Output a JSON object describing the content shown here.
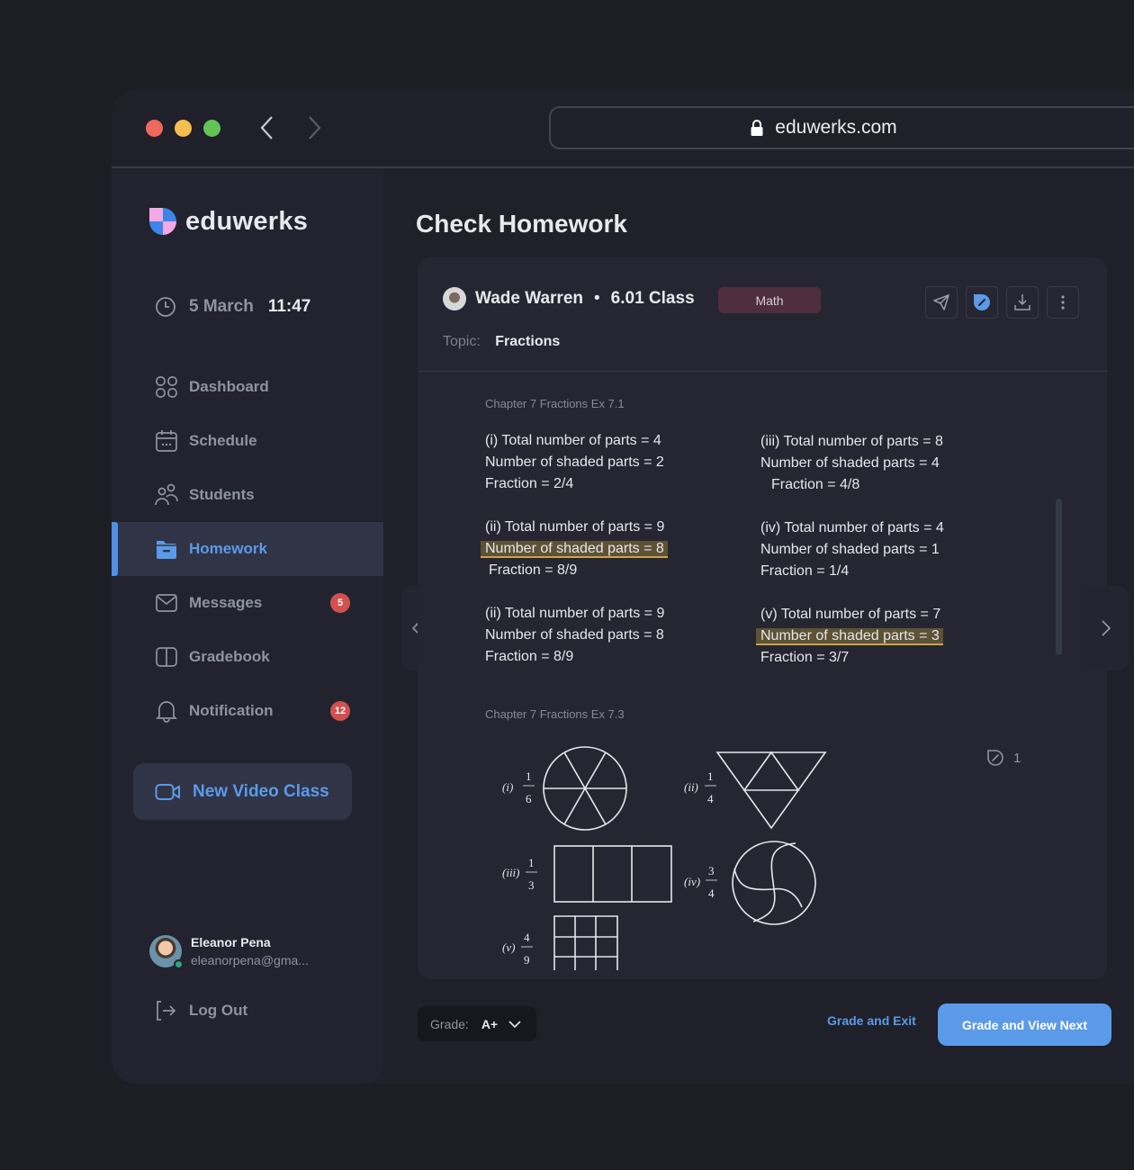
{
  "browser": {
    "url": "eduwerks.com",
    "icons": {
      "back": "chevron-left-icon",
      "forward": "chevron-right-icon",
      "lock": "lock-icon"
    }
  },
  "sidebar": {
    "brand": "eduwerks",
    "date": "5 March",
    "time": "11:47",
    "items": [
      {
        "label": "Dashboard",
        "icon": "grid-icon",
        "active": false
      },
      {
        "label": "Schedule",
        "icon": "calendar-icon",
        "active": false
      },
      {
        "label": "Students",
        "icon": "users-icon",
        "active": false
      },
      {
        "label": "Homework",
        "icon": "folder-icon",
        "active": true
      },
      {
        "label": "Messages",
        "icon": "mail-icon",
        "active": false,
        "badge": "5"
      },
      {
        "label": "Gradebook",
        "icon": "book-icon",
        "active": false
      },
      {
        "label": "Notification",
        "icon": "bell-icon",
        "active": false,
        "badge": "12"
      }
    ],
    "video_button": "New Video Class",
    "user": {
      "name": "Eleanor Pena",
      "email": "eleanorpena@gma..."
    },
    "logout": "Log Out"
  },
  "main": {
    "title": "Check Homework",
    "student": {
      "name": "Wade Warren",
      "separator": "•",
      "class": "6.01 Class"
    },
    "subject": "Math",
    "topic_label": "Topic:",
    "topic": "Fractions",
    "toolbar": [
      "send-icon",
      "annotate-icon",
      "download-icon",
      "more-icon"
    ],
    "sections": [
      {
        "label": "Chapter 7 Fractions Ex 7.1",
        "blocks": [
          {
            "lines": [
              "(i) Total number of parts = 4",
              "Number of shaded parts = 2",
              "Fraction = 2/4"
            ]
          },
          {
            "lines": [
              "(iii) Total number of parts = 8",
              "Number of shaded parts = 4",
              "Fraction = 4/8"
            ]
          },
          {
            "lines": [
              "(ii) Total number of parts = 9",
              "Number of shaded parts = 8",
              "Fraction = 8/9"
            ],
            "highlight": 1
          },
          {
            "lines": [
              "(iv) Total number of parts = 4",
              "Number of shaded parts = 1",
              "Fraction = 1/4"
            ]
          },
          {
            "lines": [
              "(ii) Total number of parts = 9",
              "Number of shaded parts = 8",
              "Fraction = 8/9"
            ]
          },
          {
            "lines": [
              "(v) Total number of parts = 7",
              "Number of shaded parts = 3",
              "Fraction = 3/7"
            ],
            "highlight": 1
          }
        ]
      },
      {
        "label": "Chapter 7 Fractions Ex 7.3",
        "figures": [
          {
            "label": "(i)",
            "num": "1",
            "den": "6"
          },
          {
            "label": "(ii)",
            "num": "1",
            "den": "4"
          },
          {
            "label": "(iii)",
            "num": "1",
            "den": "3"
          },
          {
            "label": "(iv)",
            "num": "3",
            "den": "4"
          },
          {
            "label": "(v)",
            "num": "4",
            "den": "9"
          }
        ]
      }
    ],
    "annotation_count": "1"
  },
  "footer": {
    "grade_label": "Grade:",
    "grade_value": "A+",
    "grade_exit": "Grade and Exit",
    "grade_next": "Grade and View Next"
  }
}
